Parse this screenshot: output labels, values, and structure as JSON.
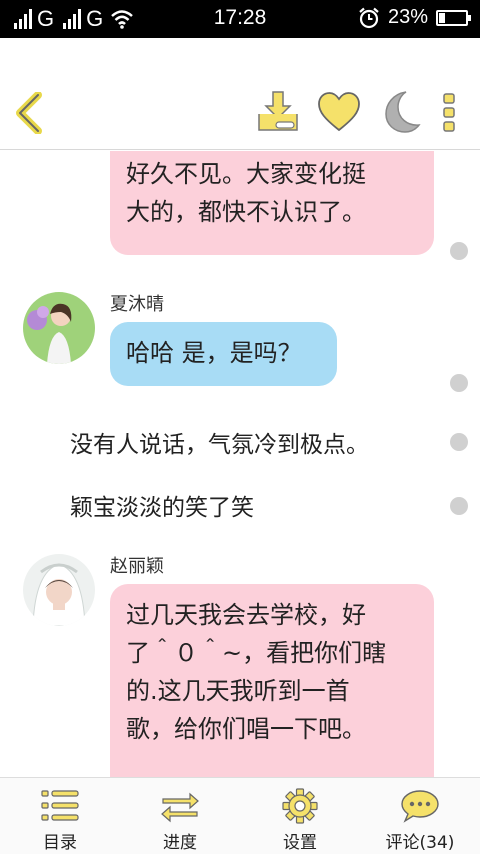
{
  "status_bar": {
    "carrier_1": "G",
    "carrier_2": "G",
    "time": "17:28",
    "battery": "23%",
    "battery_level": 0.23
  },
  "toolbar": {
    "icons": [
      "back-arrow-icon",
      "download-icon",
      "heart-icon",
      "moon-icon",
      "more-icon"
    ],
    "accent_color": "#f5e16a"
  },
  "chat": {
    "messages": [
      {
        "type": "bubble",
        "color": "pink",
        "text_lines": [
          "好久不见。大家变化挺",
          "大的，都快不认识了。"
        ]
      },
      {
        "type": "bubble",
        "color": "blue",
        "speaker": "夏沐晴",
        "text_lines": [
          "哈哈 是，是吗？"
        ]
      },
      {
        "type": "narration",
        "text": "没有人说话，气氛冷到极点。"
      },
      {
        "type": "narration",
        "text": "颖宝淡淡的笑了笑"
      },
      {
        "type": "bubble",
        "color": "pink",
        "speaker": "赵丽颖",
        "text_lines": [
          "过几天我会去学校，好",
          "了＾０＾~，看把你们瞎",
          "的.这几天我听到一首",
          "歌，给你们唱一下吧。"
        ]
      }
    ]
  },
  "bottom_nav": {
    "items": [
      {
        "label": "目录",
        "icon": "list-icon"
      },
      {
        "label": "进度",
        "icon": "progress-arrows-icon"
      },
      {
        "label": "设置",
        "icon": "gear-icon"
      },
      {
        "label": "评论(34)",
        "icon": "comment-icon"
      }
    ]
  }
}
